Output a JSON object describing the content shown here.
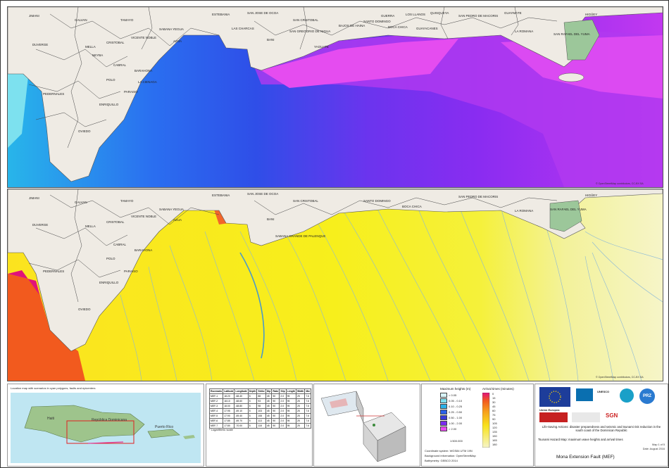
{
  "maps": {
    "top_places": [
      "JIMANI",
      "GALVAN",
      "TAMAYO",
      "VICENTE NOBLE",
      "SABANA YEGUA",
      "AZUA",
      "ESTEBANIA",
      "LAS CHARCAS",
      "SAN JOSE DE OCOA",
      "BANI",
      "YAGUATE",
      "SAN CRISTOBAL",
      "SAN GREGORIO DE NIGUA",
      "BAJOS DE HAINA",
      "SANTO DOMINGO",
      "GUERRA",
      "BOCA CHICA",
      "GUAYACANES",
      "QUISQUEYA",
      "SAN PEDRO DE MACORIS",
      "LOS LLANOS",
      "GUAYMATE",
      "LA ROMANA",
      "HIGÜEY",
      "SAN RAFAEL DEL YUMA",
      "DUVERGE",
      "MELLA",
      "CRISTOBAL",
      "CABRAL",
      "BARAHONA",
      "POLO",
      "LA CIENAGA",
      "PARAISO",
      "ENRIQUILLO",
      "PEDERNALES",
      "OVIEDO",
      "NEYBA"
    ],
    "bottom_places": [
      "JIMANI",
      "GALVAN",
      "TAMAYO",
      "VICENTE NOBLE",
      "SABANA YEGUA",
      "AZUA",
      "ESTEBANIA",
      "SAN JOSE DE OCOA",
      "BANI",
      "SABANA GRANDE DE PALENQUE",
      "SAN CRISTOBAL",
      "SANTO DOMINGO",
      "BOCA CHICA",
      "SAN PEDRO DE MACORIS",
      "LA ROMANA",
      "HIGÜEY",
      "SAN RAFAEL DEL YUMA",
      "DUVERGE",
      "MELLA",
      "CRISTOBAL",
      "CABRAL",
      "BARAHONA",
      "POLO",
      "PARAISO",
      "ENRIQUILLO",
      "PEDERNALES",
      "OVIEDO"
    ],
    "credit": "© OpenStreetMap contributors, CC-BY-SA"
  },
  "locator": {
    "title": "Location map with scenarios in cyan polygons, faults and epicenters",
    "labels": [
      "Haiti",
      "República Dominicana",
      "Puerto Rico"
    ]
  },
  "params": {
    "headers": [
      "Escenario",
      "Latitude",
      "Longitude",
      "Depth",
      "Strike",
      "Dip",
      "Rake",
      "Slip",
      "Length",
      "Width",
      "Mw"
    ],
    "rows": [
      [
        "MEF-1",
        "18.20",
        "-68.40",
        "5",
        "88",
        "45",
        "90",
        "2.0",
        "95",
        "25",
        "7.6"
      ],
      [
        "MEF-2",
        "18.10",
        "-68.60",
        "5",
        "93",
        "45",
        "90",
        "2.0",
        "95",
        "25",
        "7.6"
      ],
      [
        "MEF-3",
        "18.00",
        "-68.80",
        "5",
        "98",
        "45",
        "90",
        "2.0",
        "95",
        "25",
        "7.6"
      ],
      [
        "MEF-4",
        "17.95",
        "-69.10",
        "5",
        "103",
        "45",
        "90",
        "2.0",
        "95",
        "25",
        "7.6"
      ],
      [
        "MEF-5",
        "17.90",
        "-69.40",
        "5",
        "108",
        "45",
        "90",
        "2.0",
        "95",
        "25",
        "7.6"
      ],
      [
        "MEF-6",
        "17.85",
        "-69.70",
        "5",
        "113",
        "45",
        "90",
        "2.0",
        "95",
        "25",
        "7.6"
      ],
      [
        "MEF-7",
        "17.80",
        "-70.00",
        "5",
        "118",
        "45",
        "90",
        "2.0",
        "95",
        "25",
        "7.6"
      ]
    ],
    "note": "* Logarithmic scale"
  },
  "legend": {
    "height_title": "Maximum heights (m)",
    "height_classes": [
      {
        "label": "< 0.05",
        "color": "#d8f4f7"
      },
      {
        "label": "0.05 - 0.10",
        "color": "#7de1ef"
      },
      {
        "label": "0.10 - 0.25",
        "color": "#29b1e8"
      },
      {
        "label": "0.25 - 0.50",
        "color": "#2c62e8"
      },
      {
        "label": "0.50 - 1.00",
        "color": "#3a3ad8"
      },
      {
        "label": "1.00 - 2.00",
        "color": "#7a2bef"
      },
      {
        "label": "> 2.00",
        "color": "#e94cf0"
      }
    ],
    "time_title": "Arrival times (minutes)",
    "time_labels": [
      "0",
      "15",
      "30",
      "45",
      "60",
      "75",
      "90",
      "105",
      "120",
      "135",
      "150",
      "165",
      "180"
    ],
    "scale": "1:500.000",
    "info": [
      "Coordinate system: WGS84 UTM 19N",
      "Background information: OpenStreetMap",
      "Bathymetry: GEBCO 2014"
    ]
  },
  "credits": {
    "logos": [
      "Unión Europea",
      "UNESCO",
      "PRZ",
      "SGN"
    ],
    "title": "Life-Saving Actions: disaster preparedness and seismic and tsunami risk reduction in the south coast of the Dominican Republic",
    "subtitle": "Tsunami Hazard Map: maximum wave heights and arrival times",
    "map_no": "Map 1 of 5",
    "date": "Date: August 2016",
    "scenario": "Mona Extension Fault (MEF)"
  }
}
